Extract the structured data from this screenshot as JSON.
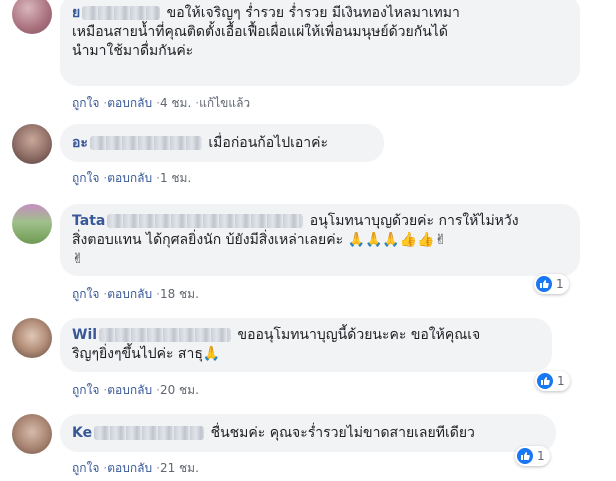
{
  "comments": [
    {
      "author_visible": "ย",
      "text_line1": "ขอให้เจริญๆ ร่ำรวย ร่ำรวย มีเงินทองไหลมาเทมา",
      "text_line2": "เหมือนสายน้ำที่คุณติดตั้งเอื้อเฟื้อเผื่อแผ่ให้เพื่อนมนุษย์ด้วยกันได้",
      "text_line3": "นำมาใช้มาดื่มกันค่ะ",
      "like": "ถูกใจ",
      "reply": "ตอบกลับ",
      "time": "4 ชม.",
      "edited": "แก้ไขแล้ว"
    },
    {
      "author_visible": "อะ",
      "text_line1": "เมื่อก่อนก้อไปเอาค่ะ",
      "like": "ถูกใจ",
      "reply": "ตอบกลับ",
      "time": "1 ชม."
    },
    {
      "author_visible": "Tata",
      "text_line1": "อนุโมทนาบุญด้วยค่ะ การให้ไม่หวัง",
      "text_line2": "สิ่งตอบแทน ได้กุศลยิ่งนัก บ้ยังมีสิ่งเหล่าเลยค่ะ 🙏🙏🙏👍👍✌",
      "text_line3": "✌",
      "like": "ถูกใจ",
      "reply": "ตอบกลับ",
      "time": "18 ชม.",
      "reaction_count": "1"
    },
    {
      "author_visible": "Wil",
      "text_line1": "ขออนุโมทนาบุญนี้ด้วยนะคะ ขอให้คุณเจ",
      "text_line2": "ริญๆยิ่งๆขึ้นไปค่ะ สาธุ🙏",
      "like": "ถูกใจ",
      "reply": "ตอบกลับ",
      "time": "20 ชม.",
      "reaction_count": "1"
    },
    {
      "author_visible": "Ke",
      "text_line1": "ชื่นชมค่ะ คุณจะร่ำรวยไม่ขาดสายเลยทีเดียว",
      "like": "ถูกใจ",
      "reply": "ตอบกลับ",
      "time": "21 ชม.",
      "reaction_count": "1"
    }
  ],
  "colors": {
    "bubble": "#f2f3f5",
    "author": "#385898",
    "meta": "#606770",
    "like_blue": "#1877f2"
  },
  "icons": {
    "reaction": "thumbs-up-icon"
  }
}
